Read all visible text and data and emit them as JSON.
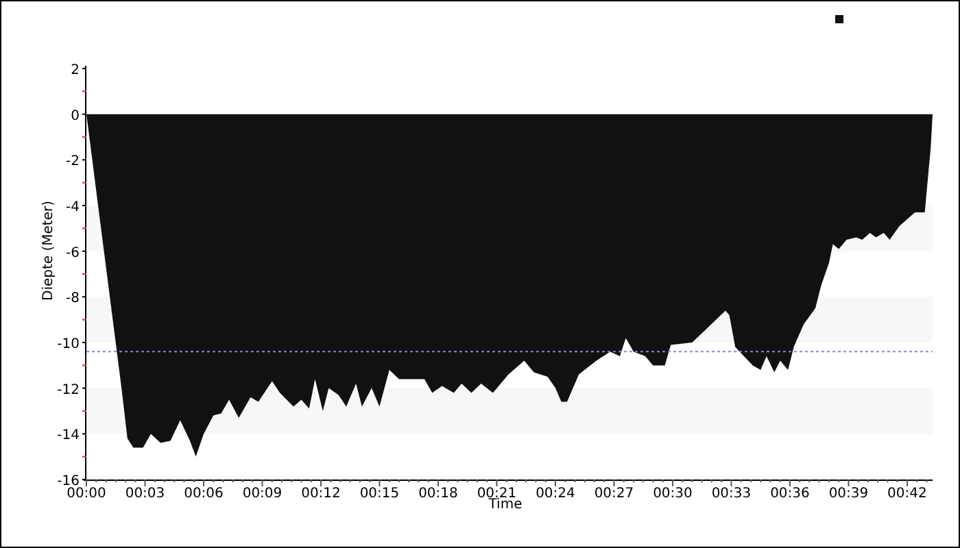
{
  "chart_data": {
    "type": "area",
    "xlabel": "Time",
    "ylabel": "Diepte (Meter)",
    "xlim": [
      0,
      43.3
    ],
    "ylim": [
      -16,
      2
    ],
    "xticks": [
      {
        "value": 0,
        "label": "00:00"
      },
      {
        "value": 3,
        "label": "00:03"
      },
      {
        "value": 6,
        "label": "00:06"
      },
      {
        "value": 9,
        "label": "00:09"
      },
      {
        "value": 12,
        "label": "00:12"
      },
      {
        "value": 15,
        "label": "00:15"
      },
      {
        "value": 18,
        "label": "00:18"
      },
      {
        "value": 21,
        "label": "00:21"
      },
      {
        "value": 24,
        "label": "00:24"
      },
      {
        "value": 27,
        "label": "00:27"
      },
      {
        "value": 30,
        "label": "00:30"
      },
      {
        "value": 33,
        "label": "00:33"
      },
      {
        "value": 36,
        "label": "00:36"
      },
      {
        "value": 39,
        "label": "00:39"
      },
      {
        "value": 42,
        "label": "00:42"
      }
    ],
    "yticks": [
      -16,
      -14,
      -12,
      -10,
      -8,
      -6,
      -4,
      -2,
      0,
      2
    ],
    "x": [
      0,
      0.3,
      0.6,
      1.2,
      1.8,
      2.1,
      2.4,
      2.9,
      3.3,
      3.8,
      4.3,
      4.8,
      5.3,
      5.6,
      6.0,
      6.5,
      6.9,
      7.3,
      7.8,
      8.4,
      8.8,
      9.5,
      9.9,
      10.6,
      11.0,
      11.4,
      11.7,
      12.1,
      12.4,
      12.9,
      13.3,
      13.8,
      14.1,
      14.6,
      15.0,
      15.5,
      16.0,
      17.3,
      17.7,
      18.2,
      18.8,
      19.2,
      19.7,
      20.2,
      20.8,
      21.6,
      22.4,
      22.9,
      23.6,
      24.0,
      24.3,
      24.6,
      25.2,
      26.1,
      26.8,
      27.3,
      27.6,
      28.0,
      28.6,
      29.0,
      29.6,
      29.9,
      31.0,
      32.7,
      32.9,
      33.2,
      34.1,
      34.5,
      34.8,
      35.2,
      35.5,
      35.9,
      36.2,
      36.7,
      37.3,
      37.6,
      38.0,
      38.2,
      38.5,
      38.9,
      39.4,
      39.7,
      40.1,
      40.4,
      40.8,
      41.1,
      41.6,
      42.0,
      42.4,
      42.9,
      43.2,
      43.3
    ],
    "series": [
      {
        "color": "#111111",
        "values": [
          0,
          -2,
          -4,
          -8,
          -12,
          -14.2,
          -14.6,
          -14.6,
          -14.0,
          -14.4,
          -14.3,
          -13.4,
          -14.3,
          -15.0,
          -14.0,
          -13.2,
          -13.1,
          -12.5,
          -13.3,
          -12.4,
          -12.6,
          -11.7,
          -12.2,
          -12.8,
          -12.5,
          -12.9,
          -11.6,
          -13.0,
          -12.0,
          -12.3,
          -12.8,
          -11.8,
          -12.8,
          -12.0,
          -12.8,
          -11.2,
          -11.6,
          -11.6,
          -12.2,
          -11.9,
          -12.2,
          -11.8,
          -12.2,
          -11.8,
          -12.2,
          -11.4,
          -10.8,
          -11.3,
          -11.5,
          -12.0,
          -12.6,
          -12.6,
          -11.4,
          -10.8,
          -10.4,
          -10.6,
          -9.8,
          -10.4,
          -10.6,
          -11.0,
          -11.0,
          -10.1,
          -10.0,
          -8.6,
          -8.8,
          -10.2,
          -11.0,
          -11.2,
          -10.6,
          -11.3,
          -10.8,
          -11.2,
          -10.2,
          -9.2,
          -8.5,
          -7.5,
          -6.5,
          -5.7,
          -5.9,
          -5.5,
          -5.4,
          -5.5,
          -5.2,
          -5.4,
          -5.2,
          -5.5,
          -4.9,
          -4.6,
          -4.3,
          -4.3,
          -1.5,
          0
        ]
      }
    ],
    "ref_lines": [
      {
        "axis": "y",
        "value": -10.4,
        "color": "#8080ff"
      }
    ]
  }
}
